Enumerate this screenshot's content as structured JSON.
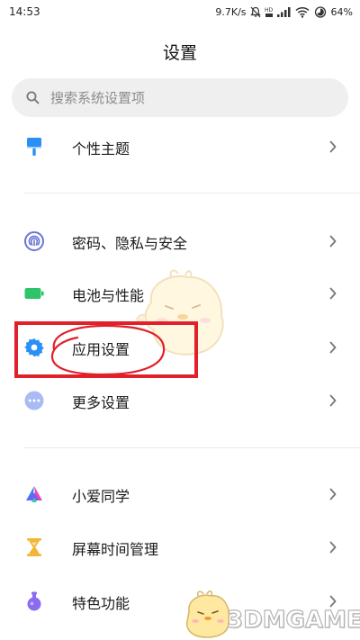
{
  "status_bar": {
    "time": "14:53",
    "net_speed": "9.7K/s",
    "battery": "64%",
    "icons": [
      "mute-icon",
      "hd-icon",
      "signal-icon",
      "wifi-icon",
      "battery-icon"
    ]
  },
  "header": {
    "title": "设置"
  },
  "search": {
    "placeholder": "搜索系统设置项"
  },
  "sections": [
    {
      "items": [
        {
          "icon": "brush-icon",
          "label": "个性主题",
          "color": "#2b90f5"
        }
      ]
    },
    {
      "items": [
        {
          "icon": "fingerprint-icon",
          "label": "密码、隐私与安全",
          "color": "#6a76d6"
        },
        {
          "icon": "battery-icon",
          "label": "电池与性能",
          "color": "#2fc46c"
        },
        {
          "icon": "gear-icon",
          "label": "应用设置",
          "color": "#2b90f5"
        },
        {
          "icon": "more-icon",
          "label": "更多设置",
          "color": "#9aaef0"
        }
      ]
    },
    {
      "items": [
        {
          "icon": "xiaoai-icon",
          "label": "小爱同学",
          "color": "#7b5cf5"
        },
        {
          "icon": "hourglass-icon",
          "label": "屏幕时间管理",
          "color": "#f2b431"
        },
        {
          "icon": "flask-icon",
          "label": "特色功能",
          "color": "#8b6cf0"
        }
      ]
    }
  ],
  "annotation": {
    "color": "#e0202a"
  },
  "watermark": {
    "text": "3DMGAME"
  }
}
